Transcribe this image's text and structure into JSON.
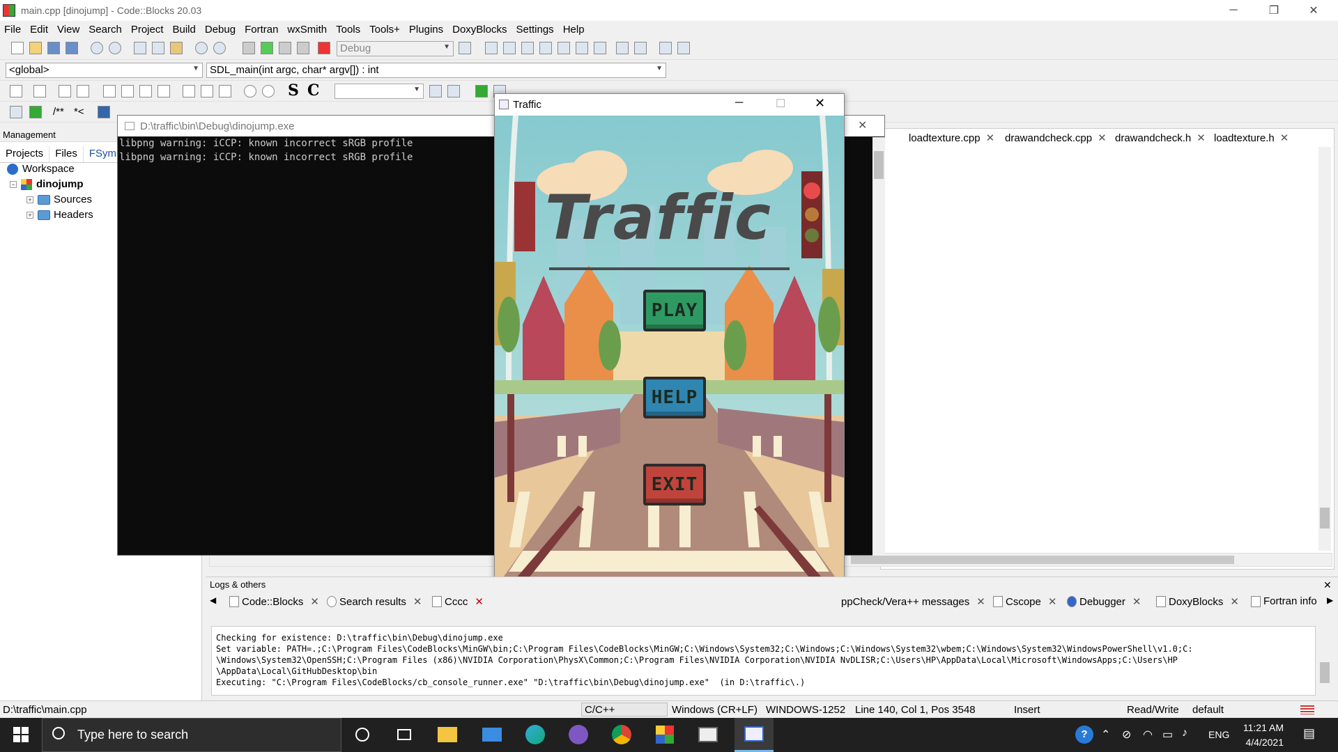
{
  "window": {
    "title": "main.cpp [dinojump] - Code::Blocks 20.03",
    "min_glyph": "─",
    "restore_glyph": "❐",
    "close_glyph": "✕"
  },
  "menu": [
    "File",
    "Edit",
    "View",
    "Search",
    "Project",
    "Build",
    "Debug",
    "Fortran",
    "wxSmith",
    "Tools",
    "Tools+",
    "Plugins",
    "DoxyBlocks",
    "Settings",
    "Help"
  ],
  "toolbar": {
    "build_target": "Debug",
    "scope": "<global>",
    "function": "SDL_main(int argc, char* argv[]) : int",
    "bold_s": "S",
    "bold_c": "C",
    "comment_block": "/**",
    "comment_line": "*<"
  },
  "management": {
    "title": "Management",
    "tabs": [
      "Projects",
      "Files",
      "FSym"
    ],
    "workspace": "Workspace",
    "project": "dinojump",
    "folders": [
      "Sources",
      "Headers"
    ]
  },
  "editor": {
    "tabs": [
      "loadtexture.cpp",
      "drawandcheck.cpp",
      "drawandcheck.h",
      "loadtexture.h"
    ]
  },
  "console": {
    "title": "D:\\traffic\\bin\\Debug\\dinojump.exe",
    "lines": [
      "libpng warning: iCCP: known incorrect sRGB profile",
      "libpng warning: iCCP: known incorrect sRGB profile"
    ]
  },
  "game": {
    "title": "Traffic",
    "logo": "Traffic",
    "buttons": {
      "play": "PLAY",
      "help": "HELP",
      "exit": "EXIT"
    },
    "colors": {
      "play": "#2e9a63",
      "help": "#2f86b0",
      "exit": "#c0443c"
    }
  },
  "logs": {
    "title": "Logs & others",
    "tabs": [
      "Code::Blocks",
      "Search results",
      "Cccc",
      "ppCheck/Vera++ messages",
      "Cscope",
      "Debugger",
      "DoxyBlocks",
      "Fortran info"
    ],
    "text": "Checking for existence: D:\\traffic\\bin\\Debug\\dinojump.exe\nSet variable: PATH=.;C:\\Program Files\\CodeBlocks\\MinGW\\bin;C:\\Program Files\\CodeBlocks\\MinGW;C:\\Windows\\System32;C:\\Windows;C:\\Windows\\System32\\wbem;C:\\Windows\\System32\\WindowsPowerShell\\v1.0;C:\n\\Windows\\System32\\OpenSSH;C:\\Program Files (x86)\\NVIDIA Corporation\\PhysX\\Common;C:\\Program Files\\NVIDIA Corporation\\NVIDIA NvDLISR;C:\\Users\\HP\\AppData\\Local\\Microsoft\\WindowsApps;C:\\Users\\HP\n\\AppData\\Local\\GitHubDesktop\\bin\nExecuting: \"C:\\Program Files\\CodeBlocks/cb_console_runner.exe\" \"D:\\traffic\\bin\\Debug\\dinojump.exe\"  (in D:\\traffic\\.)"
  },
  "status": {
    "file": "D:\\traffic\\main.cpp",
    "lang": "C/C++",
    "eol": "Windows (CR+LF)",
    "encoding": "WINDOWS-1252",
    "position": "Line 140, Col 1, Pos 3548",
    "mode": "Insert",
    "access": "Read/Write",
    "profile": "default"
  },
  "taskbar": {
    "search_placeholder": "Type here to search",
    "lang": "ENG",
    "time": "11:21 AM",
    "date": "4/4/2021"
  }
}
